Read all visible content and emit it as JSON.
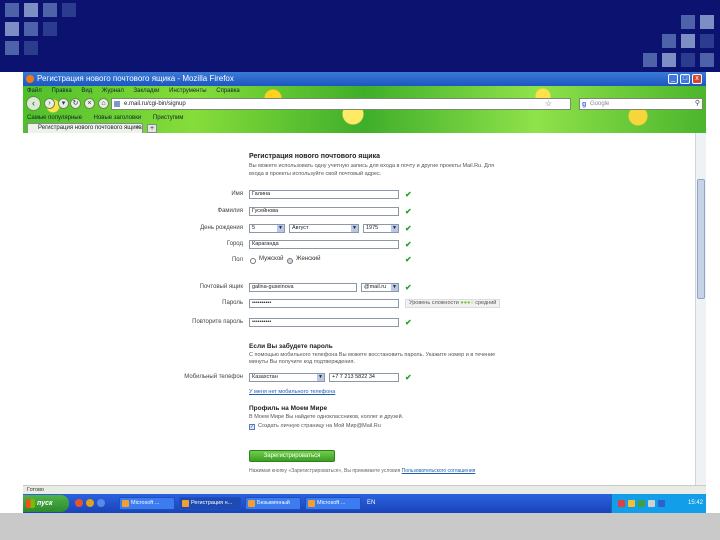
{
  "window": {
    "title": "Регистрация нового почтового ящика - Mozilla Firefox",
    "minimize": "_",
    "maximize": "□",
    "close": "x"
  },
  "menubar": [
    "Файл",
    "Правка",
    "Вид",
    "Журнал",
    "Закладки",
    "Инструменты",
    "Справка"
  ],
  "nav": {
    "back": "‹",
    "forward": "›",
    "reload": "↻",
    "stop": "×",
    "home": "⌂",
    "url": "e.mail.ru/cgi-bin/signup",
    "search_placeholder": "Google"
  },
  "bookmarks": [
    "Самые популярные",
    "Новые заголовки",
    "Приступим"
  ],
  "tabs": {
    "active_label": "Регистрация нового почтового ящика",
    "close": "×",
    "new": "+"
  },
  "form": {
    "title": "Регистрация нового почтового ящика",
    "intro": "Вы можете использовать одну учетную запись для входа в почту и другие проекты Mail.Ru. Для входа в проекты используйте свой почтовый адрес.",
    "labels": {
      "first_name": "Имя",
      "last_name": "Фамилия",
      "birthdate": "День рождения",
      "city": "Город",
      "gender": "Пол",
      "mailbox": "Почтовый ящик",
      "password": "Пароль",
      "password_repeat": "Повторите пароль"
    },
    "values": {
      "first_name": "Галина",
      "last_name": "Гусейнова",
      "day": "5",
      "month": "Август",
      "year": "1975",
      "city": "Караганда",
      "mailbox": "galina-guseinova",
      "domain": "@mail.ru",
      "password": "••••••••••",
      "password_repeat": "••••••••••"
    },
    "gender_options": [
      "Мужской",
      "Женский"
    ],
    "password_strength": {
      "label": "Уровень сложности",
      "level": "средний"
    },
    "forgot_title": "Если Вы забудете пароль",
    "forgot_note": "С помощью мобильного телефона Вы можете восстановить пароль. Укажите номер и в течение минуты Вы получите код подтверждения.",
    "phone_label": "Мобильный телефон",
    "country": "Казахстан",
    "phone": "+7 7 213 5822 34",
    "no_phone_link": "У меня нет мобильного телефона",
    "profile_title": "Профиль на Моем Мире",
    "profile_note": "В Моем Мире Вы найдете одноклассников, коллег и друзей.",
    "profile_checkbox": "Создать личную страницу на Мой Мир@Mail.Ru",
    "submit": "Зарегистрироваться",
    "terms_prefix": "Нажимая кнопку «Зарегистрироваться», Вы принимаете условия ",
    "terms_link": "Пользовательского соглашения"
  },
  "statusbar": "Готово",
  "taskbar": {
    "start": "пуск",
    "tasks": [
      "Microsoft ...",
      "Регистрация н...",
      "Безымянный",
      "Microsoft ..."
    ],
    "lang": "EN",
    "clock": "15:42"
  },
  "colors": {
    "slide_header": "#0c1270",
    "ok_check": "#2ca02c",
    "submit_green": "#3e9e25"
  }
}
